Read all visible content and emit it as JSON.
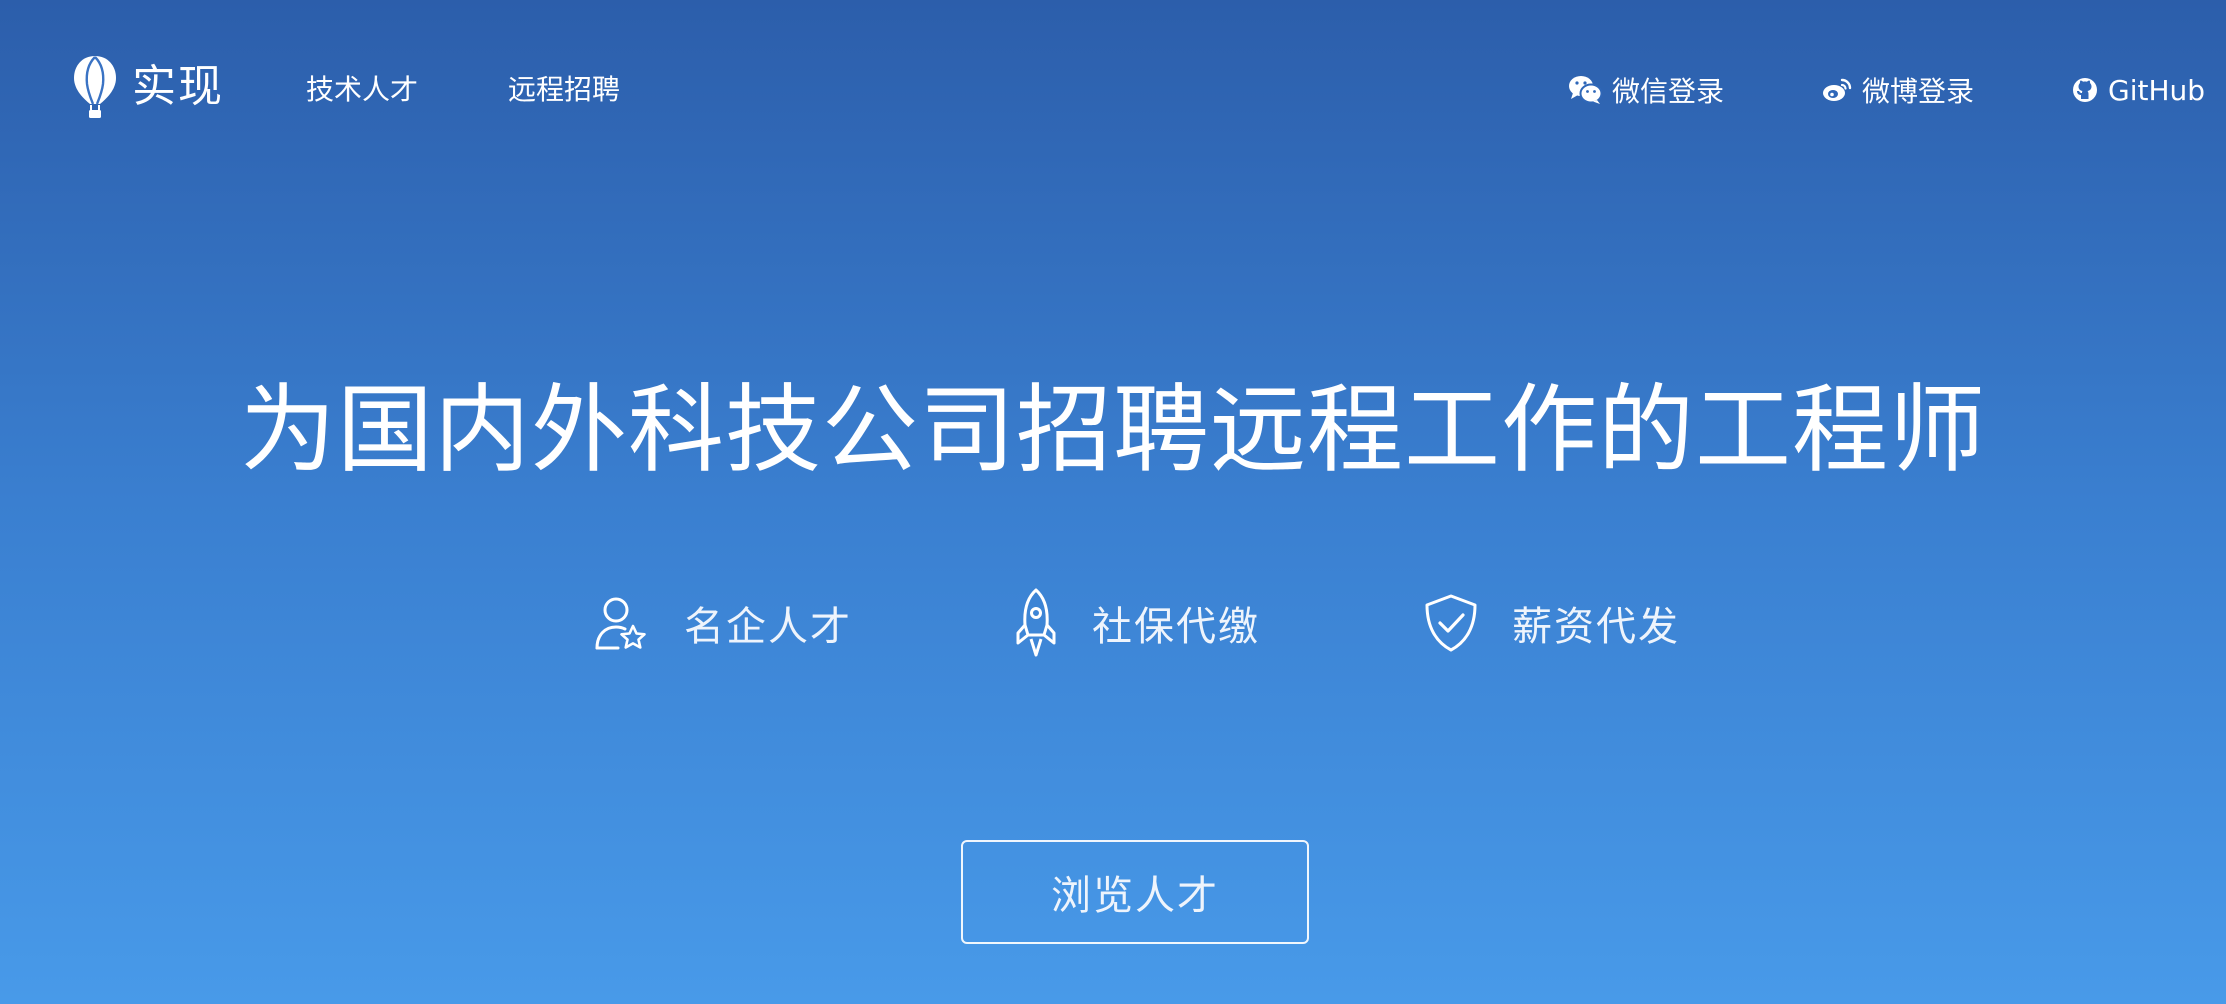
{
  "nav": {
    "brand": {
      "name": "实现",
      "icon": "balloon-logo-icon"
    },
    "links": [
      {
        "label": "技术人才"
      },
      {
        "label": "远程招聘"
      }
    ],
    "right": [
      {
        "label": "微信登录",
        "icon": "wechat-icon"
      },
      {
        "label": "微博登录",
        "icon": "weibo-icon"
      },
      {
        "label": "GitHub",
        "icon": "github-icon"
      }
    ]
  },
  "hero": {
    "headline": "为国内外科技公司招聘远程工作的工程师",
    "features": [
      {
        "label": "名企人才",
        "icon": "user-star-icon"
      },
      {
        "label": "社保代缴",
        "icon": "rocket-icon"
      },
      {
        "label": "薪资代发",
        "icon": "shield-check-icon"
      }
    ],
    "cta_label": "浏览人才"
  },
  "colors": {
    "gradient_top": "#2c5eab",
    "gradient_bottom": "#489ae9",
    "text": "#ffffff"
  }
}
